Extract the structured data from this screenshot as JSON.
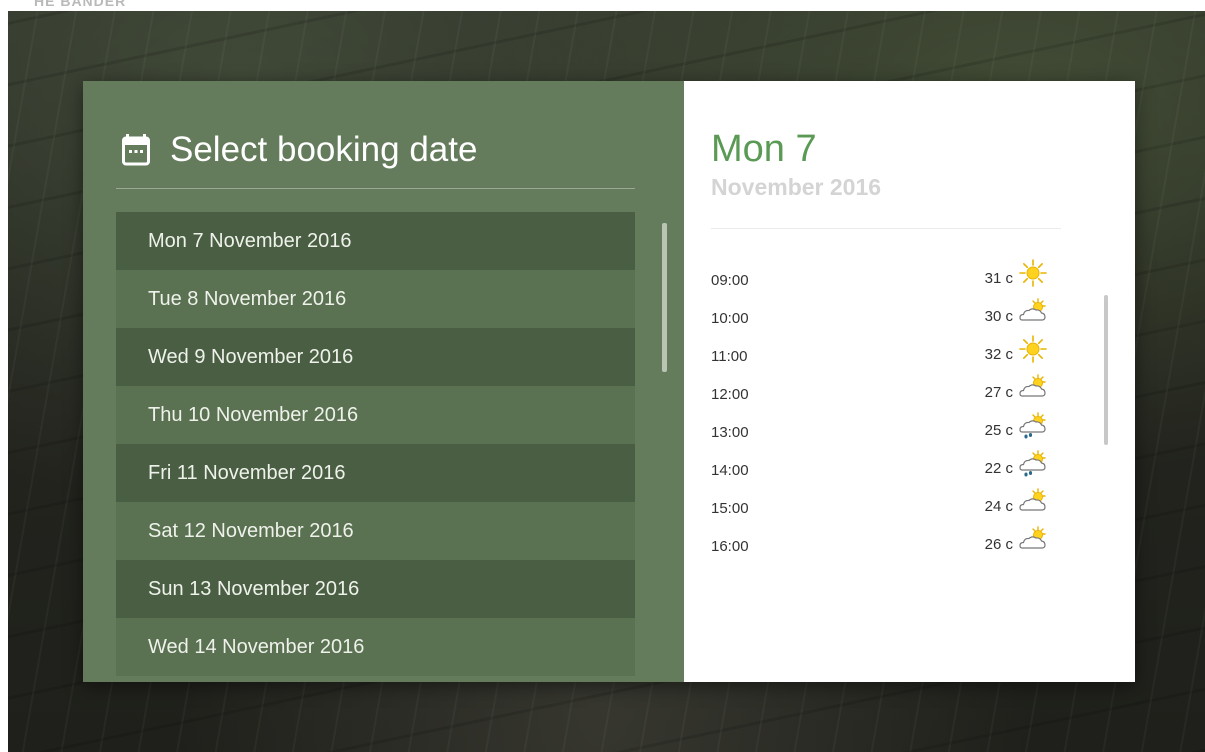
{
  "background": {
    "top_text": "HE BANDER"
  },
  "colors": {
    "panel_green": "#647c5c",
    "row_dark": "#4a5e43",
    "row_light": "#5a7152",
    "accent_green": "#5a9a54",
    "month_gray": "#d4d4d4"
  },
  "left_panel": {
    "title": "Select booking date",
    "title_icon": "calendar-icon",
    "dates": [
      {
        "label": "Mon 7 November 2016"
      },
      {
        "label": "Tue 8 November 2016"
      },
      {
        "label": "Wed 9 November 2016"
      },
      {
        "label": "Thu 10 November 2016"
      },
      {
        "label": "Fri 11 November 2016"
      },
      {
        "label": "Sat 12 November 2016"
      },
      {
        "label": "Sun 13 November 2016"
      },
      {
        "label": "Wed 14 November 2016"
      }
    ]
  },
  "right_panel": {
    "day": "Mon 7",
    "month": "November 2016",
    "hours": [
      {
        "time": "09:00",
        "temp": "31 c",
        "icon": "sunny-icon"
      },
      {
        "time": "10:00",
        "temp": "30 c",
        "icon": "partly-cloudy-icon"
      },
      {
        "time": "11:00",
        "temp": "32 c",
        "icon": "sunny-icon"
      },
      {
        "time": "12:00",
        "temp": "27 c",
        "icon": "partly-cloudy-icon"
      },
      {
        "time": "13:00",
        "temp": "25 c",
        "icon": "sun-showers-icon"
      },
      {
        "time": "14:00",
        "temp": "22 c",
        "icon": "sun-showers-icon"
      },
      {
        "time": "15:00",
        "temp": "24 c",
        "icon": "partly-cloudy-icon"
      },
      {
        "time": "16:00",
        "temp": "26 c",
        "icon": "partly-cloudy-icon"
      }
    ]
  }
}
